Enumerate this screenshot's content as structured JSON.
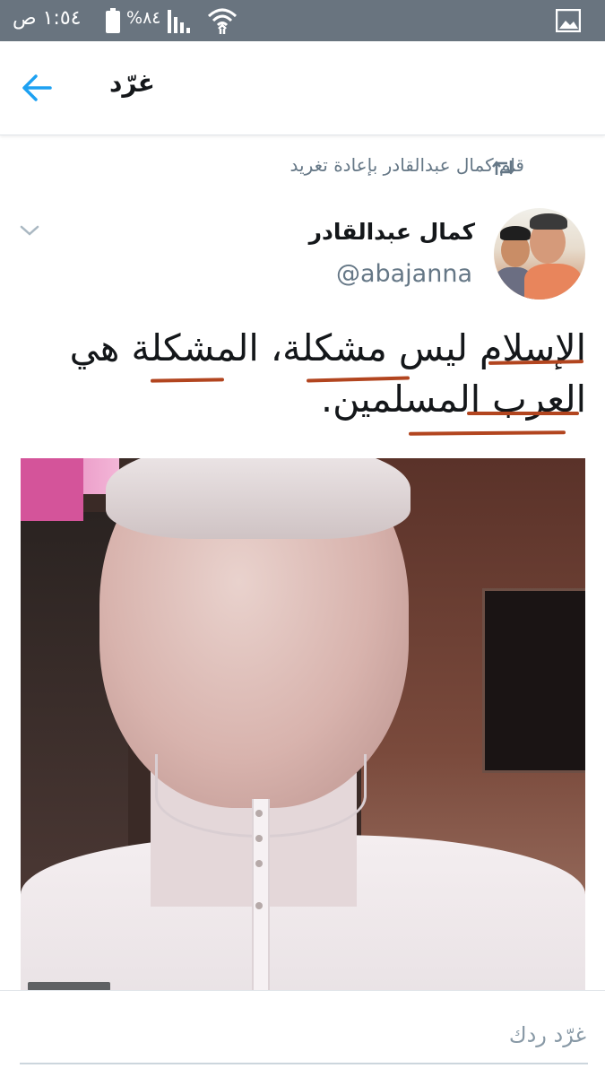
{
  "status_bar": {
    "time": "١:٥٤ ص",
    "battery_percent": "%٨٤",
    "icons": [
      "battery-icon",
      "signal-icon",
      "wifi-icon",
      "gallery-icon"
    ]
  },
  "app_bar": {
    "title": "غرّد",
    "back_icon": "arrow-left-icon"
  },
  "tweet": {
    "retweet_context": "قام كمال عبدالقادر بإعادة تغريد",
    "author_name": "كمال عبدالقادر",
    "author_handle": "@abajanna",
    "text_line1": "الإسلام ليس مشكلة، المشكلة هي",
    "text_line2": "العرب المسلمين."
  },
  "reply": {
    "placeholder": "غرّد ردك"
  },
  "colors": {
    "status_bar": "#69747f",
    "accent": "#1da1f2",
    "annotation_underline": "#b2451f",
    "secondary_text": "#657786"
  }
}
